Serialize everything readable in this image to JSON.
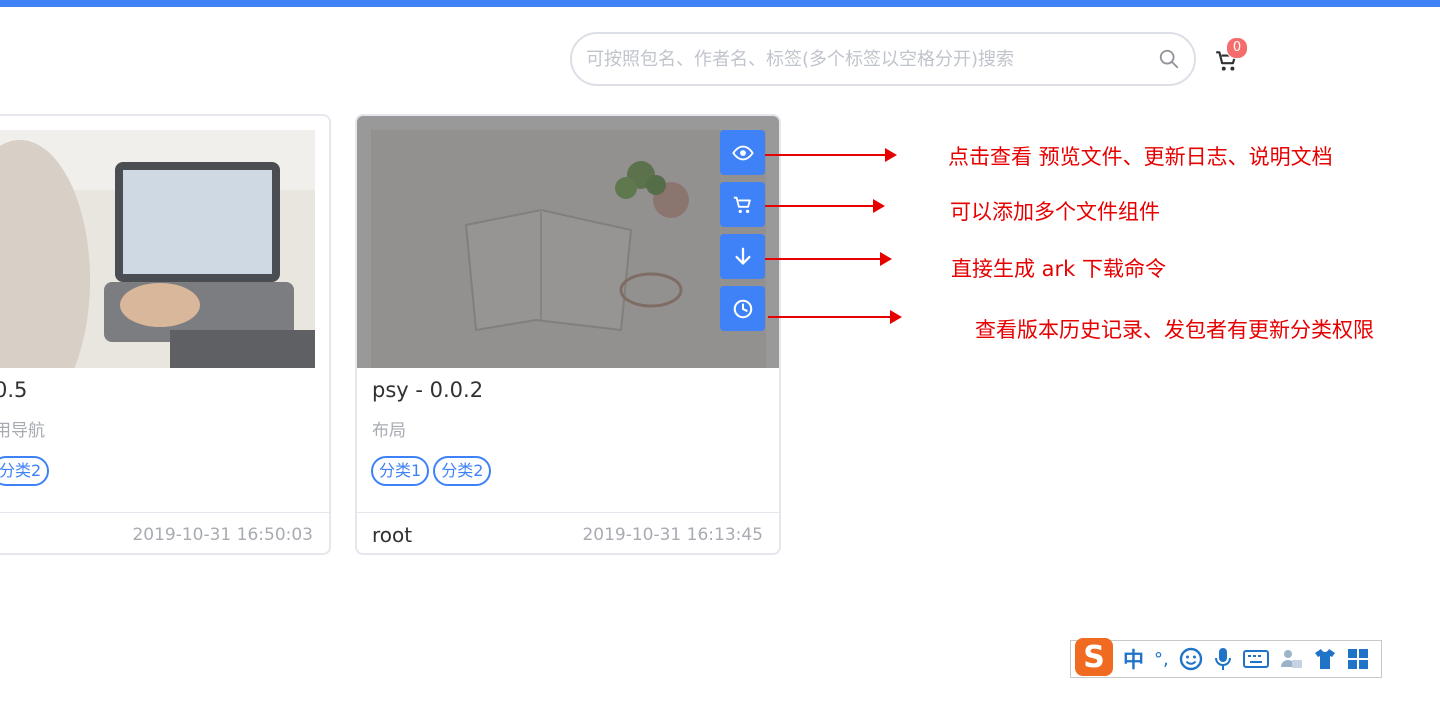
{
  "search": {
    "placeholder": "可按照包名、作者名、标签(多个标签以空格分开)搜索"
  },
  "cart": {
    "count": "0"
  },
  "cards": [
    {
      "title": "0.5",
      "description": "用导航",
      "tags": [
        "分类2"
      ],
      "author": "",
      "date": "2019-10-31 16:50:03"
    },
    {
      "title": "psy - 0.0.2",
      "description": "布局",
      "tags": [
        "分类1",
        "分类2"
      ],
      "author": "root",
      "date": "2019-10-31 16:13:45"
    }
  ],
  "actions": [
    {
      "icon": "eye-icon"
    },
    {
      "icon": "cart-icon"
    },
    {
      "icon": "download-icon"
    },
    {
      "icon": "history-clock-icon"
    }
  ],
  "annotations": [
    "点击查看  预览文件、更新日志、说明文档",
    "可以添加多个文件组件",
    "直接生成 ark 下载命令",
    "查看版本历史记录、发包者有更新分类权限"
  ],
  "ime": {
    "logo": "S",
    "mode": "中",
    "punct": "°,",
    "icons": [
      "smile-icon",
      "microphone-icon",
      "keyboard-icon",
      "user-card-icon",
      "shirt-icon",
      "grid-icon"
    ]
  },
  "colors": {
    "accent": "#3f82f7",
    "annotation": "#e60000",
    "badge": "#f56c6c"
  }
}
